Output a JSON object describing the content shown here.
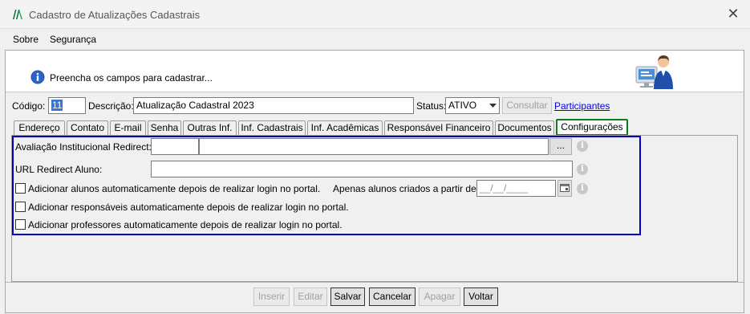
{
  "window": {
    "title": "Cadastro de Atualizações Cadastrais",
    "close_label": "✕"
  },
  "menu": [
    "Sobre",
    "Segurança"
  ],
  "banner": {
    "message": "Preencha os campos para cadastrar..."
  },
  "form": {
    "codigo_label": "Código:",
    "codigo_value": "11",
    "descricao_label": "Descrição:",
    "descricao_value": "Atualização Cadastral 2023",
    "status_label": "Status:",
    "status_value": "ATIVO",
    "consultar_label": "Consultar",
    "participantes_label": "Participantes"
  },
  "tabs": [
    "Endereço",
    "Contato",
    "E-mail",
    "Senha",
    "Outras Inf.",
    "Inf. Cadastrais",
    "Inf. Acadêmicas",
    "Responsável Financeiro",
    "Documentos",
    "Configurações"
  ],
  "config": {
    "avaliacao_label": "Avaliação Institucional Redirect:",
    "avaliacao_code": "",
    "avaliacao_desc": "",
    "browse_label": "...",
    "url_label": "URL Redirect Aluno:",
    "url_value": "",
    "add_alunos_label": "Adicionar alunos automaticamente depois de realizar login no portal.",
    "apenas_label": "Apenas alunos criados a partir de:",
    "date_placeholder": "__/__/____",
    "add_resp_label": "Adicionar responsáveis automaticamente depois de realizar login no portal.",
    "add_prof_label": "Adicionar professores automaticamente depois de realizar login no portal.",
    "info_glyph": "i"
  },
  "footer": {
    "inserir": "Inserir",
    "editar": "Editar",
    "salvar": "Salvar",
    "cancelar": "Cancelar",
    "apagar": "Apagar",
    "voltar": "Voltar"
  }
}
